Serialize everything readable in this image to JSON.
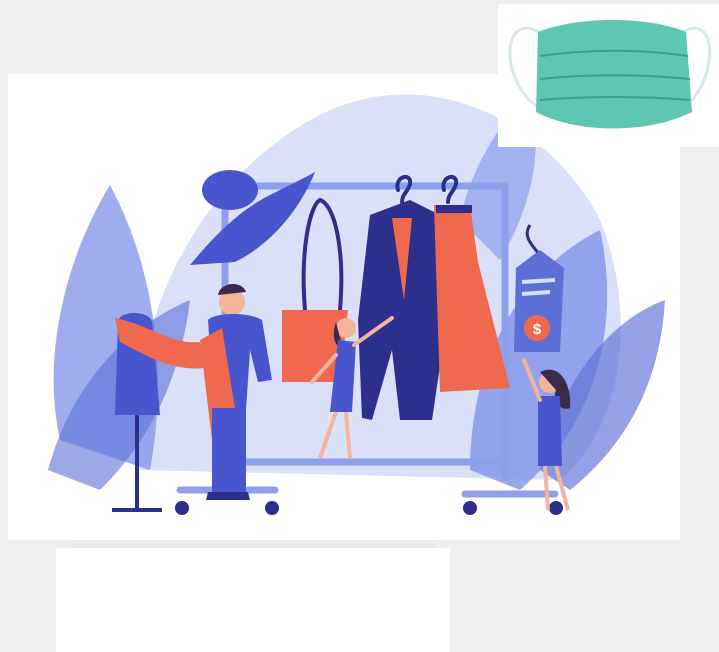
{
  "scene": {
    "background_color": "#efefef",
    "illustration": {
      "palette": {
        "leaf_light": "#d9e0f8",
        "leaf_mid": "#7f92e8",
        "leaf_dark": "#5c6fd6",
        "navy": "#2c2f8c",
        "indigo": "#4955cc",
        "coral": "#f0694f",
        "rack": "#8ea0ec",
        "skin": "#f4b49a",
        "hair": "#3c2a4a"
      },
      "tag_symbol": "$"
    },
    "mask": {
      "color": "#5dc7b1",
      "strap_color": "#d8e7ea"
    }
  }
}
